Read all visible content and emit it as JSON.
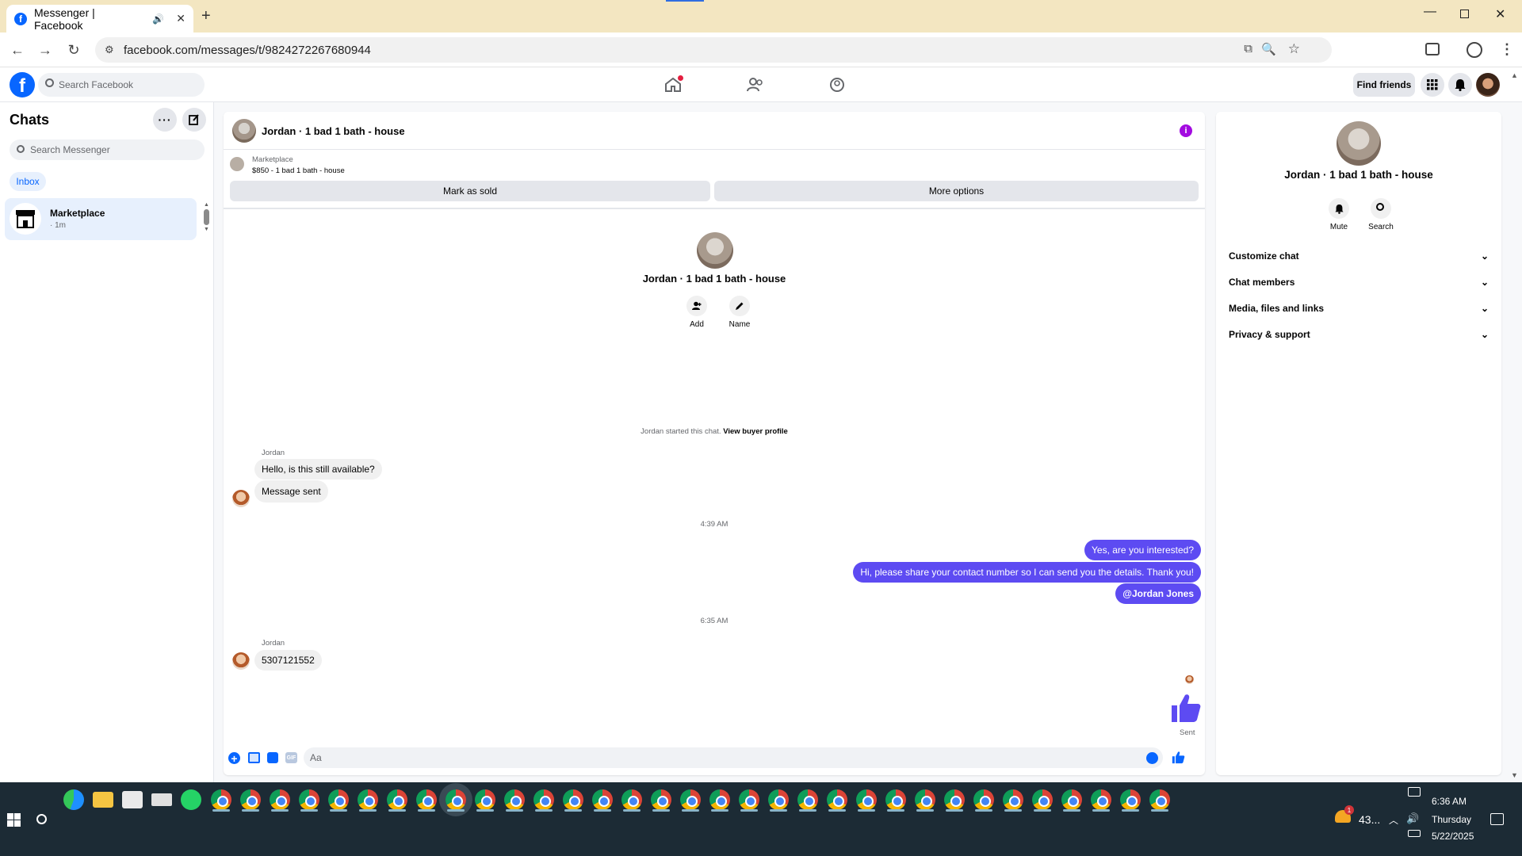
{
  "browser": {
    "tab_title": "Messenger | Facebook",
    "url": "facebook.com/messages/t/9824272267680944"
  },
  "fb_header": {
    "search_placeholder": "Search Facebook",
    "find_friends": "Find friends"
  },
  "sidebar": {
    "title": "Chats",
    "search_placeholder": "Search Messenger",
    "filter_inbox": "Inbox",
    "chats": [
      {
        "name": "Marketplace",
        "meta": "· 1m"
      }
    ]
  },
  "chat": {
    "title": "Jordan · 1 bad 1 bath - house",
    "listing_source": "Marketplace",
    "listing_price_title": "$850 - 1 bad 1 bath - house",
    "mark_sold": "Mark as sold",
    "more_options": "More options",
    "profile_name": "Jordan · 1 bad 1 bath - house",
    "add_label": "Add",
    "name_label": "Name",
    "started_text": "Jordan started this chat.",
    "view_buyer": "View buyer profile",
    "sender_1": "Jordan",
    "msg_1": "Hello, is this still available?",
    "msg_2": "Message sent",
    "time_1": "4:39 AM",
    "out_1": "Yes, are you interested?",
    "out_2": "Hi, please share your contact number so I can send you the details. Thank you!",
    "out_3": "@Jordan Jones",
    "time_2": "6:35 AM",
    "sender_2": "Jordan",
    "msg_3": "5307121552",
    "sent_status": "Sent",
    "composer_placeholder": "Aa"
  },
  "info_panel": {
    "name": "Jordan · 1 bad 1 bath - house",
    "mute": "Mute",
    "search": "Search",
    "sections": [
      "Customize chat",
      "Chat members",
      "Media, files and links",
      "Privacy & support"
    ]
  },
  "taskbar": {
    "weather": "43...",
    "weather_badge": "1",
    "time": "6:36 AM",
    "day": "Thursday",
    "date": "5/22/2025"
  },
  "colors": {
    "fb_blue": "#0866ff",
    "accent_purple": "#5d4bf2",
    "tabstrip": "#f3e6c1",
    "taskbar": "#1c2b35"
  }
}
